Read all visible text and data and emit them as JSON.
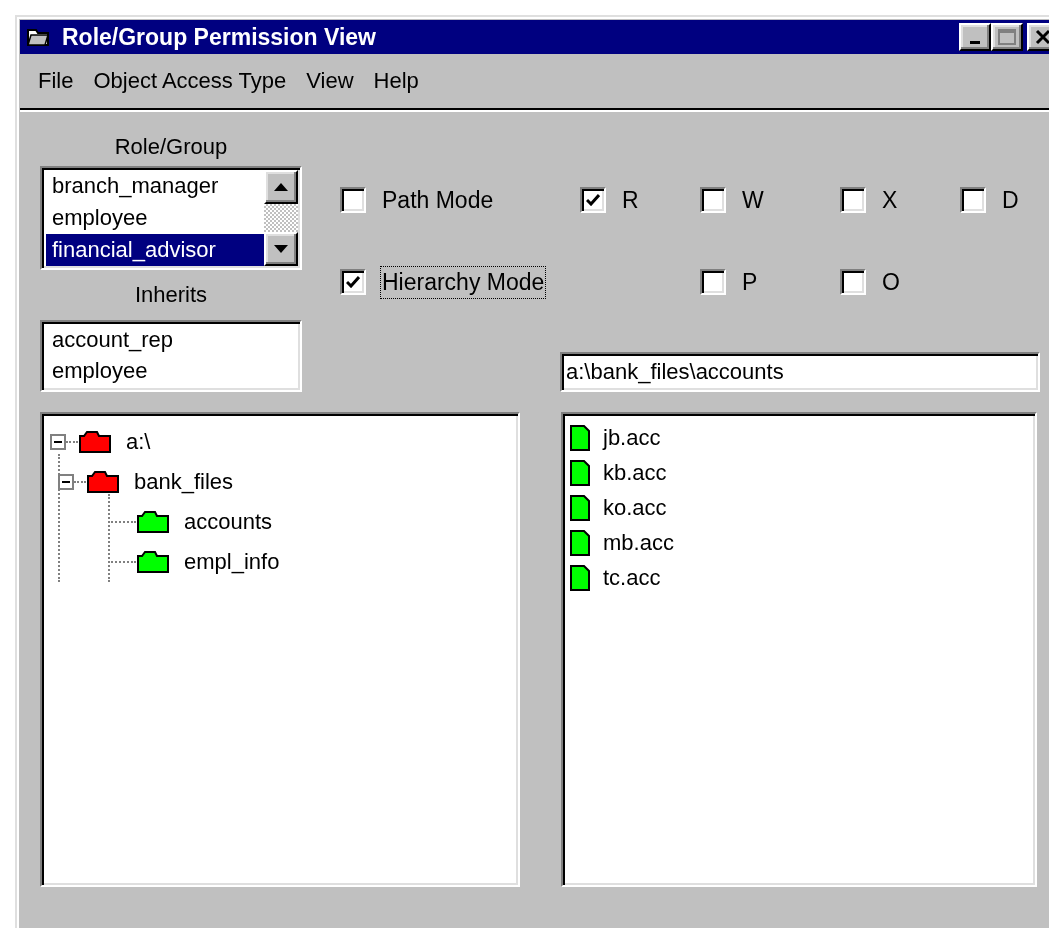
{
  "window": {
    "title": "Role/Group Permission View"
  },
  "menu": [
    {
      "label": "File"
    },
    {
      "label": "Object Access Type"
    },
    {
      "label": "View"
    },
    {
      "label": "Help"
    }
  ],
  "role_group": {
    "label": "Role/Group",
    "items": [
      {
        "text": "branch_manager",
        "selected": false
      },
      {
        "text": "employee",
        "selected": false
      },
      {
        "text": "financial_advisor",
        "selected": true
      }
    ]
  },
  "inherits": {
    "label": "Inherits",
    "items": [
      "account_rep",
      "employee"
    ]
  },
  "modes": [
    {
      "label": "Path Mode",
      "checked": false,
      "focused": false
    },
    {
      "label": "Hierarchy Mode",
      "checked": true,
      "focused": true
    }
  ],
  "permissions": [
    {
      "label": "R",
      "checked": true
    },
    {
      "label": "W",
      "checked": false
    },
    {
      "label": "X",
      "checked": false
    },
    {
      "label": "D",
      "checked": false
    },
    {
      "label": "P",
      "checked": false
    },
    {
      "label": "O",
      "checked": false
    }
  ],
  "path_field": {
    "value": "a:\\bank_files\\accounts"
  },
  "tree": [
    {
      "label": "a:\\",
      "color": "#ff0000",
      "expanded": true,
      "children": [
        {
          "label": "bank_files",
          "color": "#ff0000",
          "expanded": true,
          "children": [
            {
              "label": "accounts",
              "color": "#00ff00"
            },
            {
              "label": "empl_info",
              "color": "#00ff00"
            }
          ]
        }
      ]
    }
  ],
  "files": [
    "jb.acc",
    "kb.acc",
    "ko.acc",
    "mb.acc",
    "tc.acc"
  ]
}
